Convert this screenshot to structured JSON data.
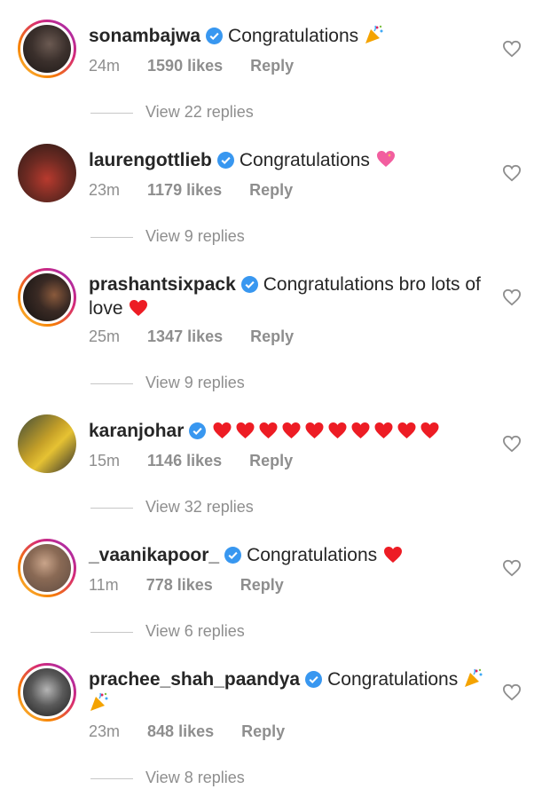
{
  "comments": [
    {
      "username": "sonambajwa",
      "text": "Congratulations",
      "emoji": [
        "party"
      ],
      "time": "24m",
      "likes": "1590 likes",
      "reply": "Reply",
      "view_replies": "View 22 replies",
      "avatar_ring": true
    },
    {
      "username": "laurengottlieb",
      "text": "Congratulations",
      "emoji": [
        "sparkling-heart"
      ],
      "time": "23m",
      "likes": "1179 likes",
      "reply": "Reply",
      "view_replies": "View 9 replies",
      "avatar_ring": false
    },
    {
      "username": "prashantsixpack",
      "text": "Congratulations bro lots of love",
      "emoji": [
        "red-heart"
      ],
      "time": "25m",
      "likes": "1347 likes",
      "reply": "Reply",
      "view_replies": "View 9 replies",
      "avatar_ring": true
    },
    {
      "username": "karanjohar",
      "text": "",
      "emoji": [
        "red-heart",
        "red-heart",
        "red-heart",
        "red-heart",
        "red-heart",
        "red-heart",
        "red-heart",
        "red-heart",
        "red-heart",
        "red-heart"
      ],
      "time": "15m",
      "likes": "1146 likes",
      "reply": "Reply",
      "view_replies": "View 32 replies",
      "avatar_ring": false
    },
    {
      "username": "_vaanikapoor_",
      "text": "Congratulations",
      "emoji": [
        "red-heart"
      ],
      "time": "11m",
      "likes": "778 likes",
      "reply": "Reply",
      "view_replies": "View 6 replies",
      "avatar_ring": true
    },
    {
      "username": "prachee_shah_paandya",
      "text": "Congratulations",
      "emoji": [
        "party",
        "party"
      ],
      "time": "23m",
      "likes": "848 likes",
      "reply": "Reply",
      "view_replies": "View 8 replies",
      "avatar_ring": true
    }
  ],
  "colors": {
    "text": "#262626",
    "muted": "#8e8e8e",
    "verified": "#3897f0",
    "heart_red": "#ed1c24"
  }
}
